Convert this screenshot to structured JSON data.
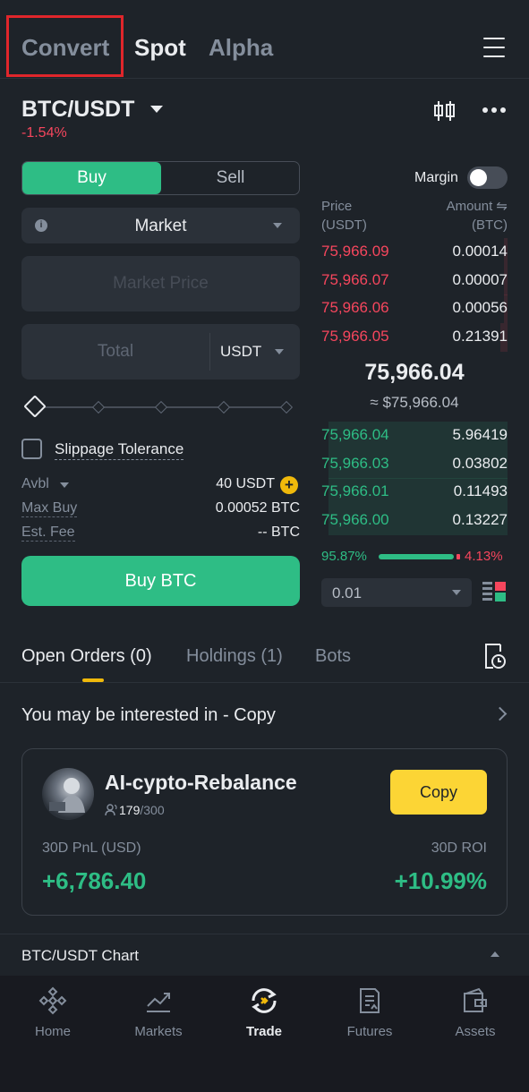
{
  "top_tabs": {
    "convert": "Convert",
    "spot": "Spot",
    "alpha": "Alpha"
  },
  "pair": {
    "symbol": "BTC/USDT",
    "change": "-1.54%"
  },
  "order_form": {
    "buy_label": "Buy",
    "sell_label": "Sell",
    "order_type": "Market",
    "market_price_placeholder": "Market Price",
    "total_placeholder": "Total",
    "total_unit": "USDT",
    "slippage_label": "Slippage Tolerance",
    "avbl_label": "Avbl",
    "avbl_value": "40 USDT",
    "max_buy_label": "Max Buy",
    "max_buy_value": "0.00052 BTC",
    "est_fee_label": "Est. Fee",
    "est_fee_value": "-- BTC",
    "submit_label": "Buy BTC"
  },
  "order_book": {
    "margin_label": "Margin",
    "margin_enabled": false,
    "price_header": "Price\n(USDT)",
    "amount_header": "Amount ⇋\n(BTC)",
    "asks": [
      {
        "price": "75,966.09",
        "amount": "0.00014",
        "depth": 0.02
      },
      {
        "price": "75,966.07",
        "amount": "0.00007",
        "depth": 0.02
      },
      {
        "price": "75,966.06",
        "amount": "0.00056",
        "depth": 0.02
      },
      {
        "price": "75,966.05",
        "amount": "0.21391",
        "depth": 0.04
      }
    ],
    "last_price": "75,966.04",
    "last_price_usd": "≈ $75,966.04",
    "bids": [
      {
        "price": "75,966.04",
        "amount": "5.96419",
        "depth": 0.96
      },
      {
        "price": "75,966.03",
        "amount": "0.03802",
        "depth": 0.96
      },
      {
        "price": "75,966.01",
        "amount": "0.11493",
        "depth": 0.96
      },
      {
        "price": "75,966.00",
        "amount": "0.13227",
        "depth": 0.96
      }
    ],
    "buy_ratio": "95.87%",
    "sell_ratio": "4.13%",
    "tick_size": "0.01"
  },
  "section_tabs": {
    "open_orders": "Open Orders (0)",
    "holdings": "Holdings (1)",
    "bots": "Bots"
  },
  "interest": {
    "title": "You may be interested in - Copy",
    "bot_name": "AI-cypto-Rebalance",
    "followers": "179",
    "followers_max": "/300",
    "copy_label": "Copy",
    "pnl_label": "30D PnL (USD)",
    "pnl_value": "+6,786.40",
    "roi_label": "30D ROI",
    "roi_value": "+10.99%"
  },
  "chart_bar": {
    "title": "BTC/USDT Chart"
  },
  "bottom_nav": {
    "home": "Home",
    "markets": "Markets",
    "trade": "Trade",
    "futures": "Futures",
    "assets": "Assets"
  },
  "colors": {
    "buy": "#2ebd85",
    "sell": "#f6465d",
    "accent": "#f0b90b",
    "copy": "#fcd535",
    "bg": "#1e2329"
  }
}
